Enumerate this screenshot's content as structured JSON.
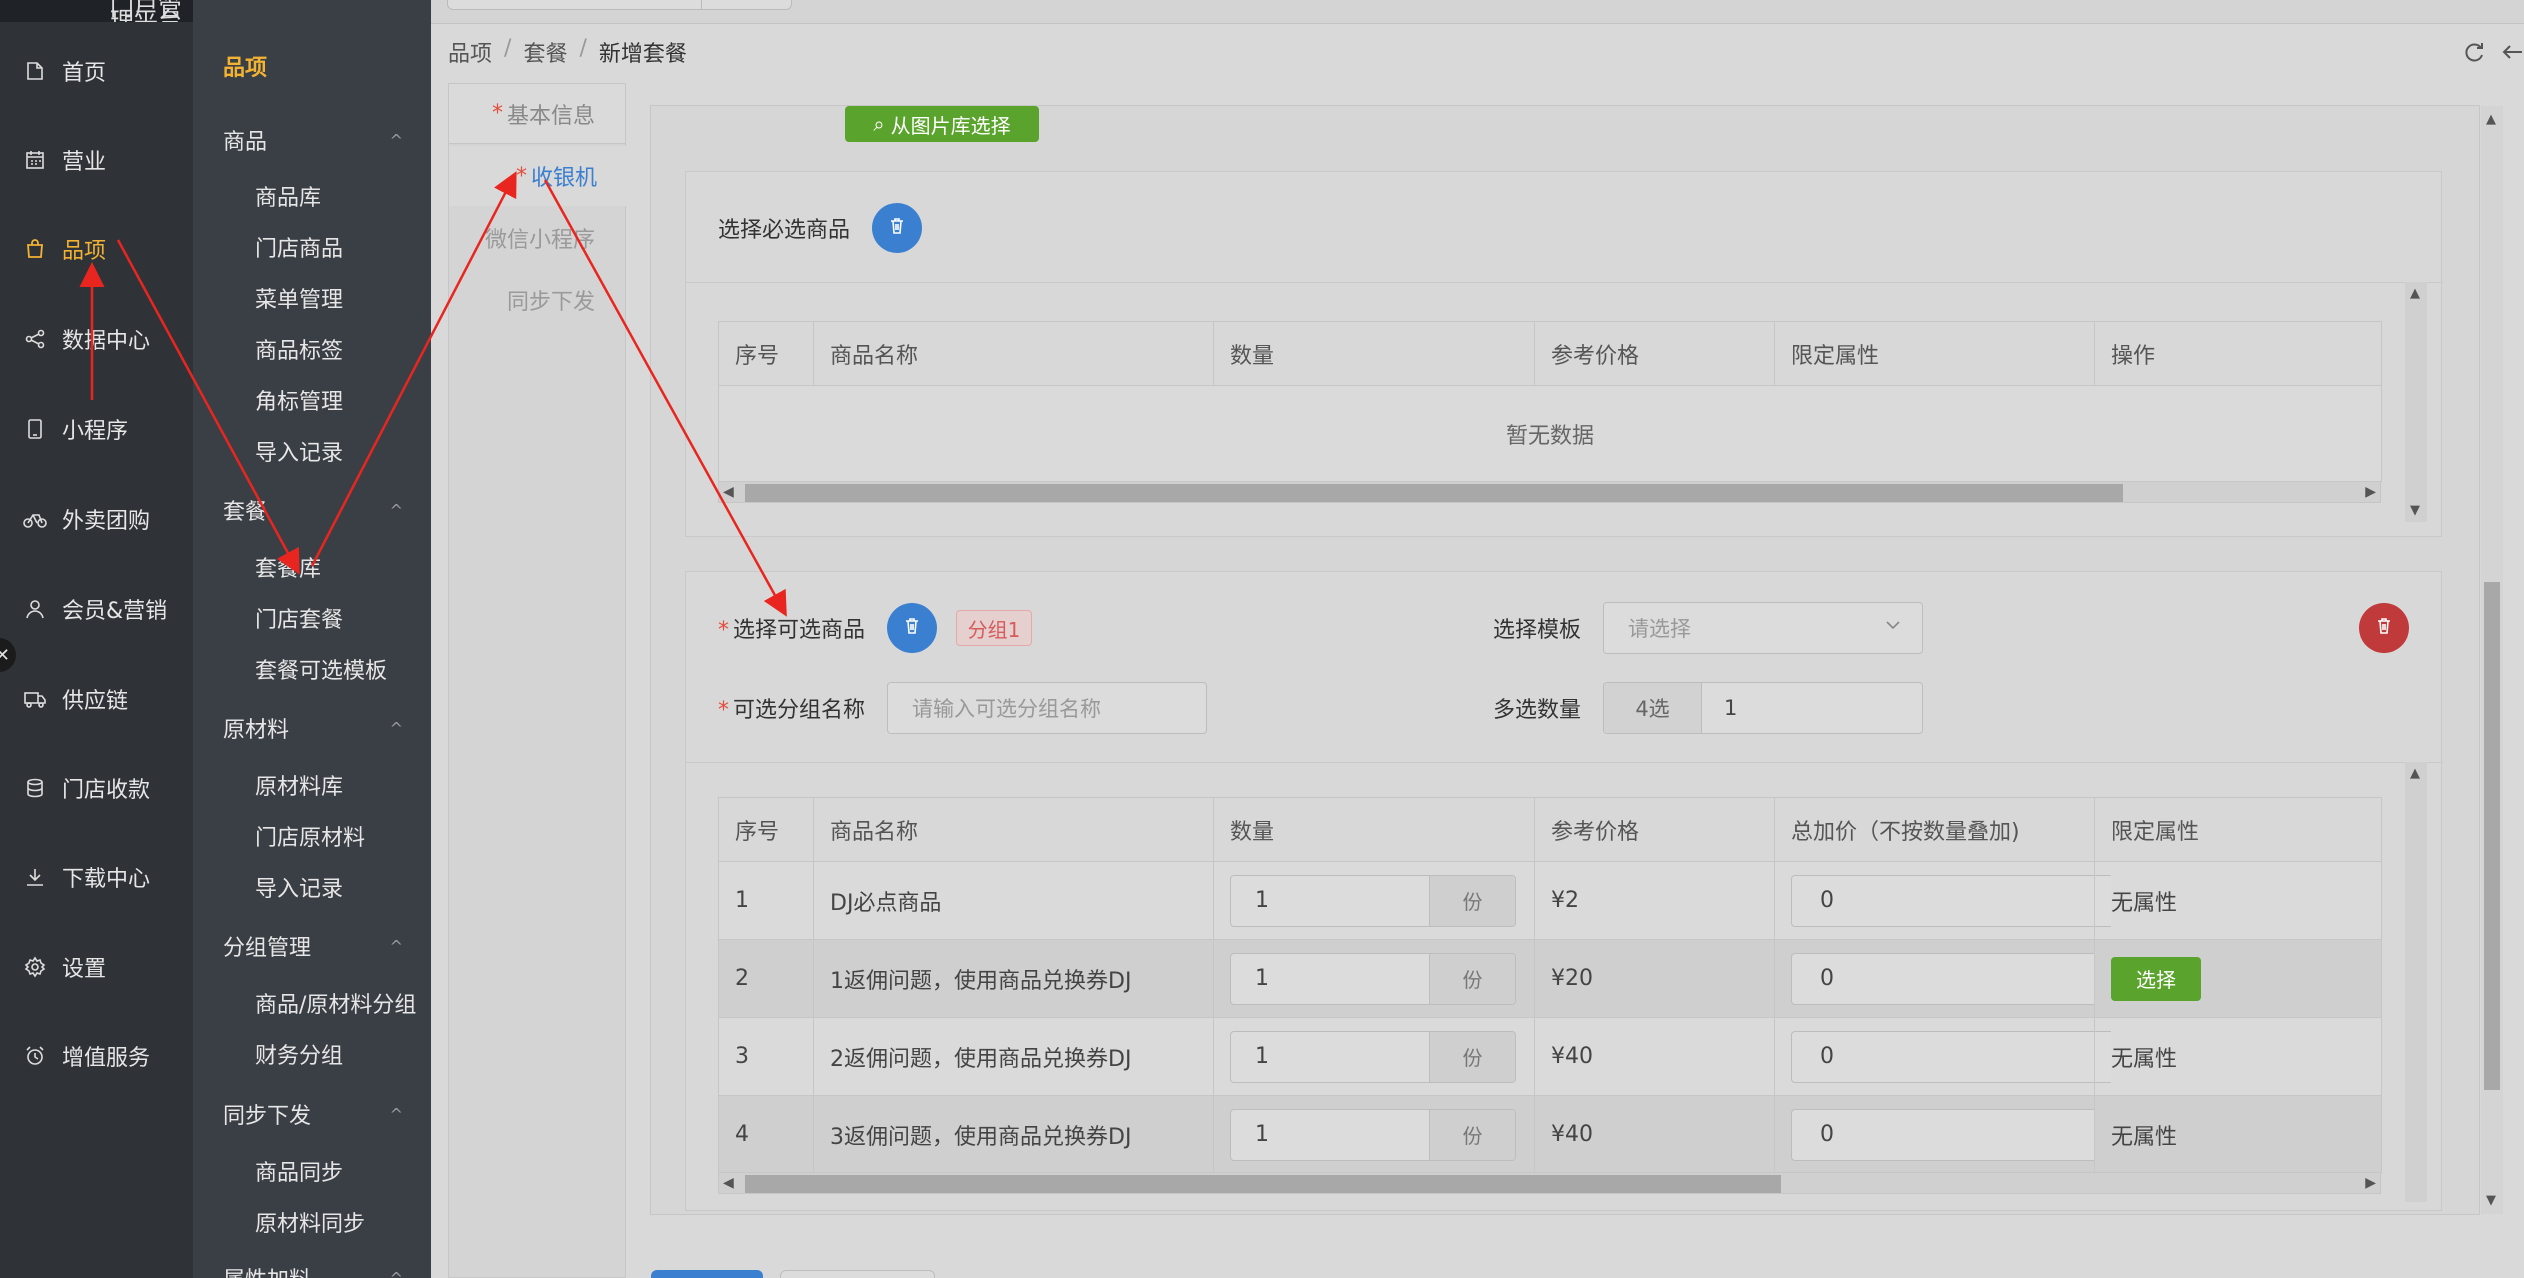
{
  "nav": {
    "top_text": "门户管理平台",
    "items": [
      {
        "label": "首页",
        "icon": "document-icon"
      },
      {
        "label": "营业",
        "icon": "calendar-icon"
      },
      {
        "label": "品项",
        "icon": "shopping-bag-icon"
      },
      {
        "label": "数据中心",
        "icon": "share-icon"
      },
      {
        "label": "小程序",
        "icon": "tablet-icon"
      },
      {
        "label": "外卖团购",
        "icon": "bicycle-icon"
      },
      {
        "label": "会员&营销",
        "icon": "user-icon"
      },
      {
        "label": "供应链",
        "icon": "truck-icon"
      },
      {
        "label": "门店收款",
        "icon": "database-icon"
      },
      {
        "label": "下载中心",
        "icon": "download-icon"
      },
      {
        "label": "设置",
        "icon": "gear-icon"
      },
      {
        "label": "增值服务",
        "icon": "alarm-icon"
      }
    ],
    "active_index": 2
  },
  "subnav": {
    "title": "品项",
    "groups": [
      {
        "label": "商品",
        "items": [
          "商品库",
          "门店商品",
          "菜单管理",
          "商品标签",
          "角标管理",
          "导入记录"
        ]
      },
      {
        "label": "套餐",
        "items": [
          "套餐库",
          "门店套餐",
          "套餐可选模板"
        ]
      },
      {
        "label": "原材料",
        "items": [
          "原材料库",
          "门店原材料",
          "导入记录"
        ]
      },
      {
        "label": "分组管理",
        "items": [
          "商品/原材料分组",
          "财务分组"
        ]
      },
      {
        "label": "同步下发",
        "items": [
          "商品同步",
          "原材料同步"
        ]
      },
      {
        "label": "属性加料",
        "items": []
      }
    ]
  },
  "breadcrumb": [
    "品项",
    "套餐",
    "新增套餐"
  ],
  "steps": [
    {
      "label": "基本信息",
      "required": true
    },
    {
      "label": "收银机",
      "required": true
    },
    {
      "label": "微信小程序",
      "required": false
    },
    {
      "label": "同步下发",
      "required": false
    }
  ],
  "image_library_button": "从图片库选择",
  "required_section": {
    "title": "选择必选商品",
    "columns": [
      "序号",
      "商品名称",
      "数量",
      "参考价格",
      "限定属性",
      "操作"
    ],
    "empty_text": "暂无数据"
  },
  "optional_section": {
    "select_label": "选择可选商品",
    "group_tag": "分组1",
    "template_label": "选择模板",
    "template_placeholder": "请选择",
    "group_name_label": "可选分组名称",
    "group_name_placeholder": "请输入可选分组名称",
    "multi_label": "多选数量",
    "multi_prefix": "4选",
    "multi_value": "1",
    "columns": [
      "序号",
      "商品名称",
      "数量",
      "参考价格",
      "总加价（不按数量叠加)",
      "限定属性"
    ],
    "rows": [
      {
        "no": "1",
        "name": "DJ必点商品",
        "qty": "1",
        "unit": "份",
        "price": "¥2",
        "extra": "0",
        "attr": "无属性"
      },
      {
        "no": "2",
        "name": "1返佣问题，使用商品兑换券DJ",
        "qty": "1",
        "unit": "份",
        "price": "¥20",
        "extra": "0",
        "attr": "选择"
      },
      {
        "no": "3",
        "name": "2返佣问题，使用商品兑换券DJ",
        "qty": "1",
        "unit": "份",
        "price": "¥40",
        "extra": "0",
        "attr": "无属性"
      },
      {
        "no": "4",
        "name": "3返佣问题，使用商品兑换券DJ",
        "qty": "1",
        "unit": "份",
        "price": "¥40",
        "extra": "0",
        "attr": "无属性"
      }
    ]
  },
  "colors": {
    "nav_bg": "#2f3338",
    "subnav_bg": "#3a3f45",
    "accent": "#f2b233",
    "primary": "#3a7fd0",
    "success": "#5aa32c",
    "danger": "#c0393b",
    "annotation": "#e8261f"
  }
}
